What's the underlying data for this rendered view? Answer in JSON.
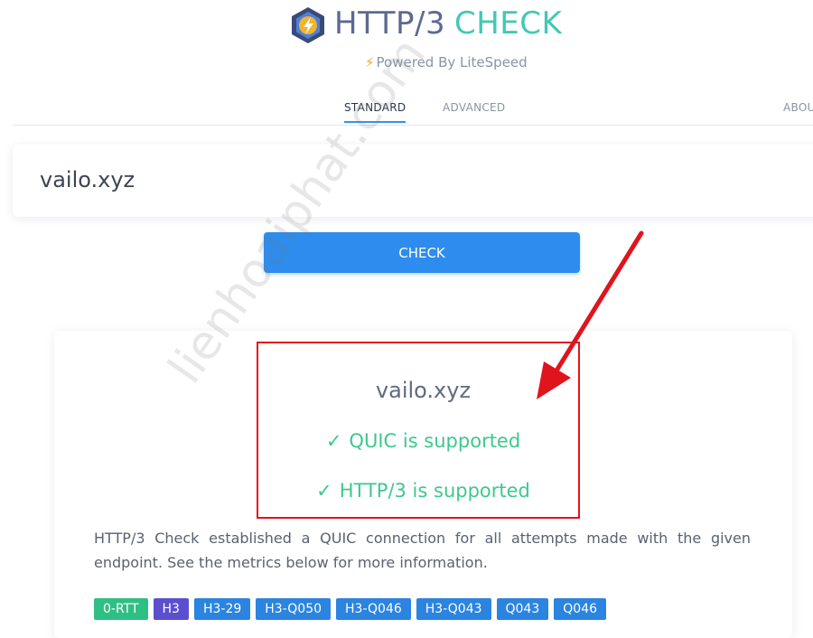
{
  "header": {
    "brand_part1": "HTTP/3",
    "brand_part2": "CHECK",
    "powered_by": "Powered By LiteSpeed",
    "logo_icon": "litespeed-bolt-hexagon-icon"
  },
  "nav": {
    "tabs": [
      {
        "label": "STANDARD",
        "active": true
      },
      {
        "label": "ADVANCED",
        "active": false
      },
      {
        "label": "ABOU",
        "active": false
      }
    ]
  },
  "search": {
    "value": "vailo.xyz"
  },
  "check_button": {
    "label": "CHECK"
  },
  "result": {
    "domain": "vailo.xyz",
    "status_lines": [
      {
        "icon": "checkmark-icon",
        "text": "QUIC is supported"
      },
      {
        "icon": "checkmark-icon",
        "text": "HTTP/3 is supported"
      }
    ],
    "description": "HTTP/3 Check established a QUIC connection for all attempts made with the given endpoint. See the metrics below for more information.",
    "badges": [
      {
        "label": "0-RTT",
        "color": "#2ebf84"
      },
      {
        "label": "H3",
        "color": "#5b4fcf"
      },
      {
        "label": "H3-29",
        "color": "#2a84e0"
      },
      {
        "label": "H3-Q050",
        "color": "#2a84e0"
      },
      {
        "label": "H3-Q046",
        "color": "#2a84e0"
      },
      {
        "label": "H3-Q043",
        "color": "#2a84e0"
      },
      {
        "label": "Q043",
        "color": "#2a84e0"
      },
      {
        "label": "Q046",
        "color": "#2a84e0"
      }
    ]
  },
  "overlay": {
    "watermark": "lienhoaiphat.com",
    "annotation_color": "#e0141d"
  },
  "colors": {
    "accent": "#2d8ced",
    "brand_teal": "#42c9b4",
    "brand_slate": "#5b6a92",
    "success": "#3dc88f"
  }
}
